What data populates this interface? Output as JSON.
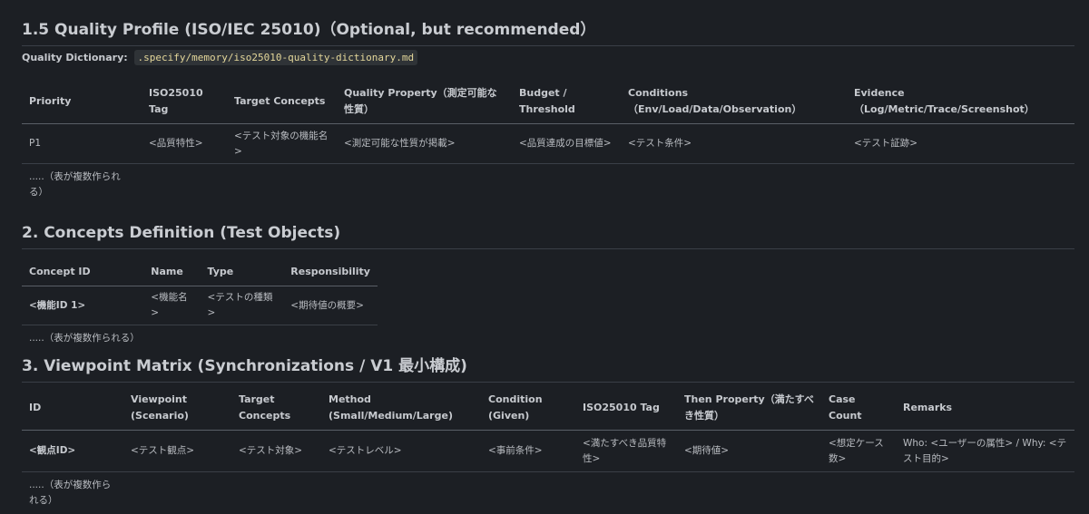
{
  "section_15": {
    "heading": "1.5 Quality Profile (ISO/IEC 25010)（Optional, but recommended）",
    "dict_label": "Quality Dictionary:",
    "dict_path": ".specify/memory/iso25010-quality-dictionary.md",
    "headers": [
      "Priority",
      "ISO25010 Tag",
      "Target Concepts",
      "Quality Property（測定可能な性質）",
      "Budget / Threshold",
      "Conditions（Env/Load/Data/Observation）",
      "Evidence（Log/Metric/Trace/Screenshot）"
    ],
    "row": [
      "P1",
      "<品質特性>",
      "<テスト対象の機能名>",
      "<測定可能な性質が掲載>",
      "<品質達成の目標値>",
      "<テスト条件>",
      "<テスト証跡>"
    ],
    "note": ".....（表が複数作られる）"
  },
  "section_2": {
    "heading": "2. Concepts Definition (Test Objects)",
    "headers": [
      "Concept ID",
      "Name",
      "Type",
      "Responsibility"
    ],
    "row": [
      "<機能ID 1>",
      "<機能名>",
      "<テストの種類>",
      "<期待値の概要>"
    ],
    "note": ".....（表が複数作られる）"
  },
  "section_3": {
    "heading": "3. Viewpoint Matrix (Synchronizations / V1 最小構成)",
    "headers": [
      "ID",
      "Viewpoint (Scenario)",
      "Target Concepts",
      "Method (Small/Medium/Large)",
      "Condition (Given)",
      "ISO25010 Tag",
      "Then Property（満たすべき性質）",
      "Case Count",
      "Remarks"
    ],
    "row": [
      "<観点ID>",
      "<テスト観点>",
      "<テスト対象>",
      "<テストレベル>",
      "<事前条件>",
      "<満たすべき品質特性>",
      "<期待値>",
      "<想定ケース数>",
      "Who: <ユーザーの属性> / Why: <テスト目的>"
    ],
    "note": ".....（表が複数作られる）"
  }
}
